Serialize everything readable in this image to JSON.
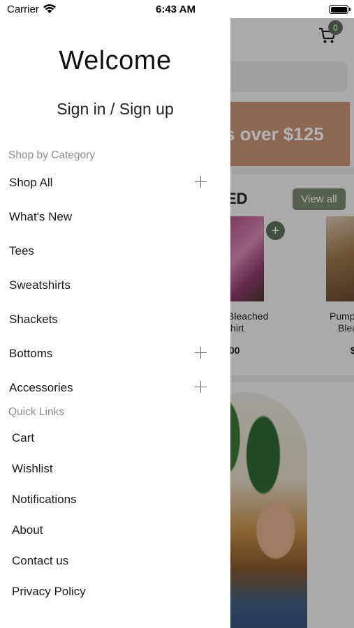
{
  "status_bar": {
    "carrier": "Carrier",
    "time": "6:43 AM",
    "icons": [
      "wifi-icon",
      "battery-icon"
    ]
  },
  "drawer": {
    "title": "Welcome",
    "auth_link": "Sign in / Sign up",
    "shop_section_label": "Shop by Category",
    "categories": [
      {
        "label": "Shop All",
        "expandable": true
      },
      {
        "label": "What's New",
        "expandable": false
      },
      {
        "label": "Tees",
        "expandable": false
      },
      {
        "label": "Sweatshirts",
        "expandable": false
      },
      {
        "label": "Shackets",
        "expandable": false
      },
      {
        "label": "Bottoms",
        "expandable": true
      },
      {
        "label": "Accessories",
        "expandable": true
      }
    ],
    "quick_section_label": "Quick Links",
    "quick_links": [
      "Cart",
      "Wishlist",
      "Notifications",
      "About",
      "Contact us",
      "Privacy Policy"
    ]
  },
  "background": {
    "cart_count": "0",
    "banner_text": "s over $125",
    "section_title": "ED",
    "view_all_label": "View all",
    "add_label": "+",
    "products": [
      {
        "name_line1": "Bleached",
        "name_line2": "hirt",
        "price": "00"
      },
      {
        "name_line1": "Pump",
        "name_line2": "Blea",
        "price": "$"
      }
    ]
  },
  "colors": {
    "accent_green": "#7c8a74",
    "badge_green": "#5e6d5c",
    "banner_brown": "#c99677",
    "section_label_gray": "#8c8c8c"
  }
}
